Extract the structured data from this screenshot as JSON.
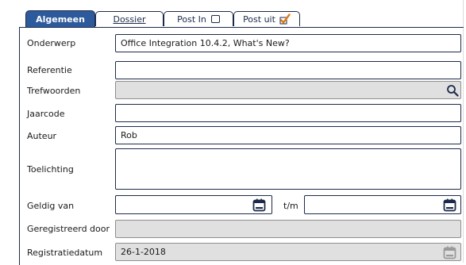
{
  "tabs": [
    {
      "label": "Algemeen",
      "active": true
    },
    {
      "label": "Dossier",
      "active": false
    },
    {
      "label": "Post In",
      "active": false,
      "checkbox_checked": false
    },
    {
      "label": "Post uit",
      "active": false,
      "checked_icon": "checkmark-icon"
    }
  ],
  "form": {
    "onderwerp": {
      "label": "Onderwerp",
      "value": "Office Integration 10.4.2, What's New?"
    },
    "referentie": {
      "label": "Referentie",
      "value": ""
    },
    "trefwoorden": {
      "label": "Trefwoorden",
      "value": "",
      "icon": "search-icon"
    },
    "jaarcode": {
      "label": "Jaarcode",
      "value": ""
    },
    "auteur": {
      "label": "Auteur",
      "value": "Rob"
    },
    "toelichting": {
      "label": "Toelichting",
      "value": ""
    },
    "geldig_van": {
      "label": "Geldig van",
      "value": "",
      "separator": "t/m",
      "value_to": "",
      "icon": "calendar-icon"
    },
    "geregistreerd_door": {
      "label": "Geregistreerd door",
      "value": ""
    },
    "registratiedatum": {
      "label": "Registratiedatum",
      "value": "26-1-2018",
      "icon": "calendar-icon"
    }
  },
  "colors": {
    "accent": "#2d5a9c",
    "border": "#1c2a4a",
    "disabled_bg": "#e0e0e0",
    "check": "#e07a10"
  }
}
